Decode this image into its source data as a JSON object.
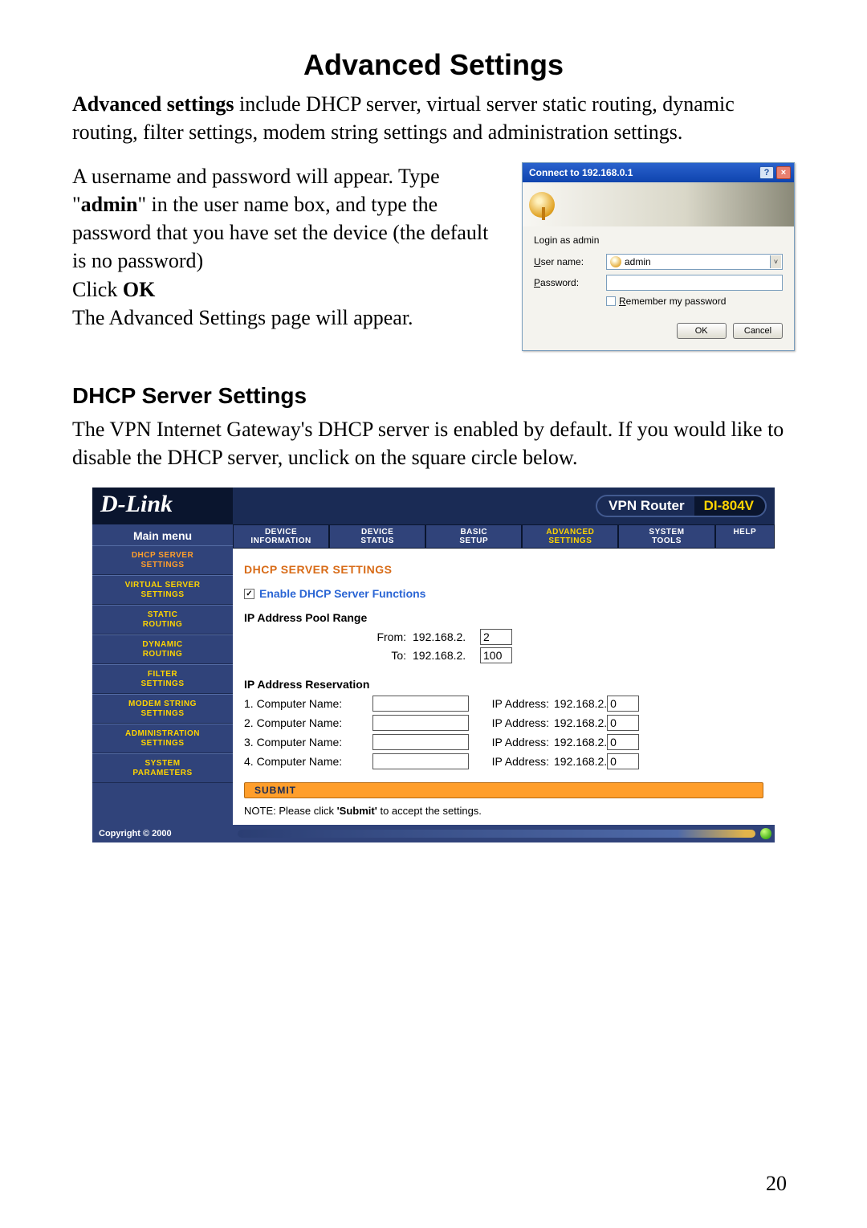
{
  "title": "Advanced Settings",
  "intro_lead": "Advanced settings",
  "intro_rest": " include DHCP server, virtual server static routing, dynamic routing, filter settings, modem string settings and administration settings.",
  "body2a": "A username and password will appear. Type \"",
  "body2b": "admin",
  "body2c": "\" in the user name box, and type the password that you have set the device (the default is no password)",
  "click_label": "Click ",
  "ok_word": "OK",
  "body3": "The Advanced Settings page will appear.",
  "dialog": {
    "title": "Connect to 192.168.0.1",
    "help_sym": "?",
    "close_sym": "×",
    "realm": "Login as admin",
    "user_label": "User name:",
    "user_value": "admin",
    "pass_label": "Password:",
    "remember": "Remember my password",
    "ok": "OK",
    "cancel": "Cancel",
    "chevron": "˅"
  },
  "h2": "DHCP Server Settings",
  "h2_body": "The VPN Internet Gateway's DHCP server is enabled by default. If you would like to disable the DHCP server, unclick on the square circle below.",
  "router": {
    "logo": "D-Link",
    "pill_left": "VPN Router",
    "pill_right": "DI-804V",
    "tabs": [
      {
        "l1": "DEVICE",
        "l2": "INFORMATION",
        "id": "device-info"
      },
      {
        "l1": "DEVICE",
        "l2": "STATUS",
        "id": "device-status"
      },
      {
        "l1": "BASIC",
        "l2": "SETUP",
        "id": "basic-setup"
      },
      {
        "l1": "ADVANCED",
        "l2": "SETTINGS",
        "id": "advanced-settings"
      },
      {
        "l1": "SYSTEM",
        "l2": "TOOLS",
        "id": "system-tools"
      },
      {
        "l1": "HELP",
        "l2": "",
        "id": "help"
      }
    ],
    "main_menu": "Main menu",
    "sidebar": [
      {
        "l1": "DHCP SERVER",
        "l2": "SETTINGS",
        "id": "dhcp-server-settings"
      },
      {
        "l1": "VIRTUAL SERVER",
        "l2": "SETTINGS",
        "id": "virtual-server-settings"
      },
      {
        "l1": "STATIC",
        "l2": "ROUTING",
        "id": "static-routing"
      },
      {
        "l1": "DYNAMIC",
        "l2": "ROUTING",
        "id": "dynamic-routing"
      },
      {
        "l1": "FILTER",
        "l2": "SETTINGS",
        "id": "filter-settings"
      },
      {
        "l1": "MODEM STRING",
        "l2": "SETTINGS",
        "id": "modem-string-settings"
      },
      {
        "l1": "ADMINISTRATION",
        "l2": "SETTINGS",
        "id": "administration-settings"
      },
      {
        "l1": "SYSTEM",
        "l2": "PARAMETERS",
        "id": "system-parameters"
      }
    ],
    "section_title": "DHCP SERVER SETTINGS",
    "check_mark": "✓",
    "enable_label": "Enable DHCP Server Functions",
    "range_label": "IP Address Pool Range",
    "from_label": "From:",
    "to_label": "To:",
    "ip_prefix": "192.168.2.",
    "from_value": "2",
    "to_value": "100",
    "res_label": "IP Address Reservation",
    "reservations": [
      {
        "idx": "1. Computer Name:",
        "name": "",
        "ip": "0"
      },
      {
        "idx": "2. Computer Name:",
        "name": "",
        "ip": "0"
      },
      {
        "idx": "3. Computer Name:",
        "name": "",
        "ip": "0"
      },
      {
        "idx": "4. Computer Name:",
        "name": "",
        "ip": "0"
      }
    ],
    "ip_addr_label": "IP Address:",
    "submit": "SUBMIT",
    "note_a": "NOTE: Please click ",
    "note_b": "'Submit'",
    "note_c": " to accept the settings.",
    "copyright": "Copyright © 2000"
  },
  "page_number": "20"
}
